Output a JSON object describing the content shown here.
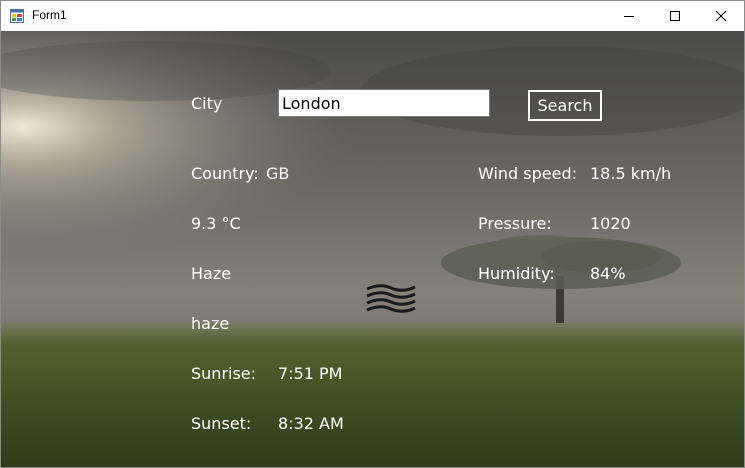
{
  "window": {
    "title": "Form1"
  },
  "search": {
    "city_label": "City",
    "city_value": "London",
    "button_label": "Search"
  },
  "weather": {
    "country_label": "Country:",
    "country_value": "GB",
    "temperature": "9.3 °C",
    "condition_main": "Haze",
    "condition_description": "haze",
    "condition_icon": "haze-icon",
    "sunrise_label": "Sunrise:",
    "sunrise_value": "7:51 PM",
    "sunset_label": "Sunset:",
    "sunset_value": "8:32 AM",
    "wind_label": "Wind speed:",
    "wind_value": "18.5 km/h",
    "pressure_label": "Pressure:",
    "pressure_value": "1020",
    "humidity_label": "Humidity:",
    "humidity_value": "84%"
  },
  "colors": {
    "label_text": "#ffffff",
    "icon": "#1a1a1a"
  }
}
